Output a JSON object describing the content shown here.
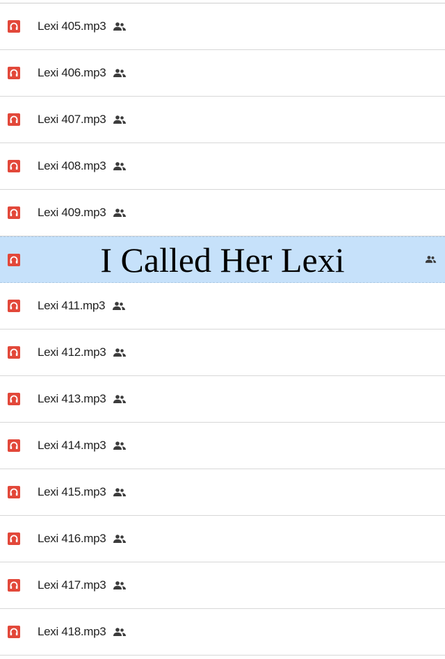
{
  "colors": {
    "audio_icon": "#e2483a",
    "row_highlight": "#c6e1fa",
    "divider": "#d7d7d7",
    "share_icon": "#3c3c3c",
    "text": "#222222"
  },
  "icons": {
    "file": "audio-file-icon",
    "shared": "shared-people-icon"
  },
  "title_overlay": "I Called Her Lexi",
  "files": [
    {
      "name": "Lexi 405.mp3"
    },
    {
      "name": "Lexi 406.mp3"
    },
    {
      "name": "Lexi 407.mp3"
    },
    {
      "name": "Lexi 408.mp3"
    },
    {
      "name": "Lexi 409.mp3"
    },
    {
      "name": ""
    },
    {
      "name": "Lexi 411.mp3"
    },
    {
      "name": "Lexi 412.mp3"
    },
    {
      "name": "Lexi 413.mp3"
    },
    {
      "name": "Lexi 414.mp3"
    },
    {
      "name": "Lexi 415.mp3"
    },
    {
      "name": "Lexi 416.mp3"
    },
    {
      "name": "Lexi 417.mp3"
    },
    {
      "name": "Lexi 418.mp3"
    }
  ]
}
